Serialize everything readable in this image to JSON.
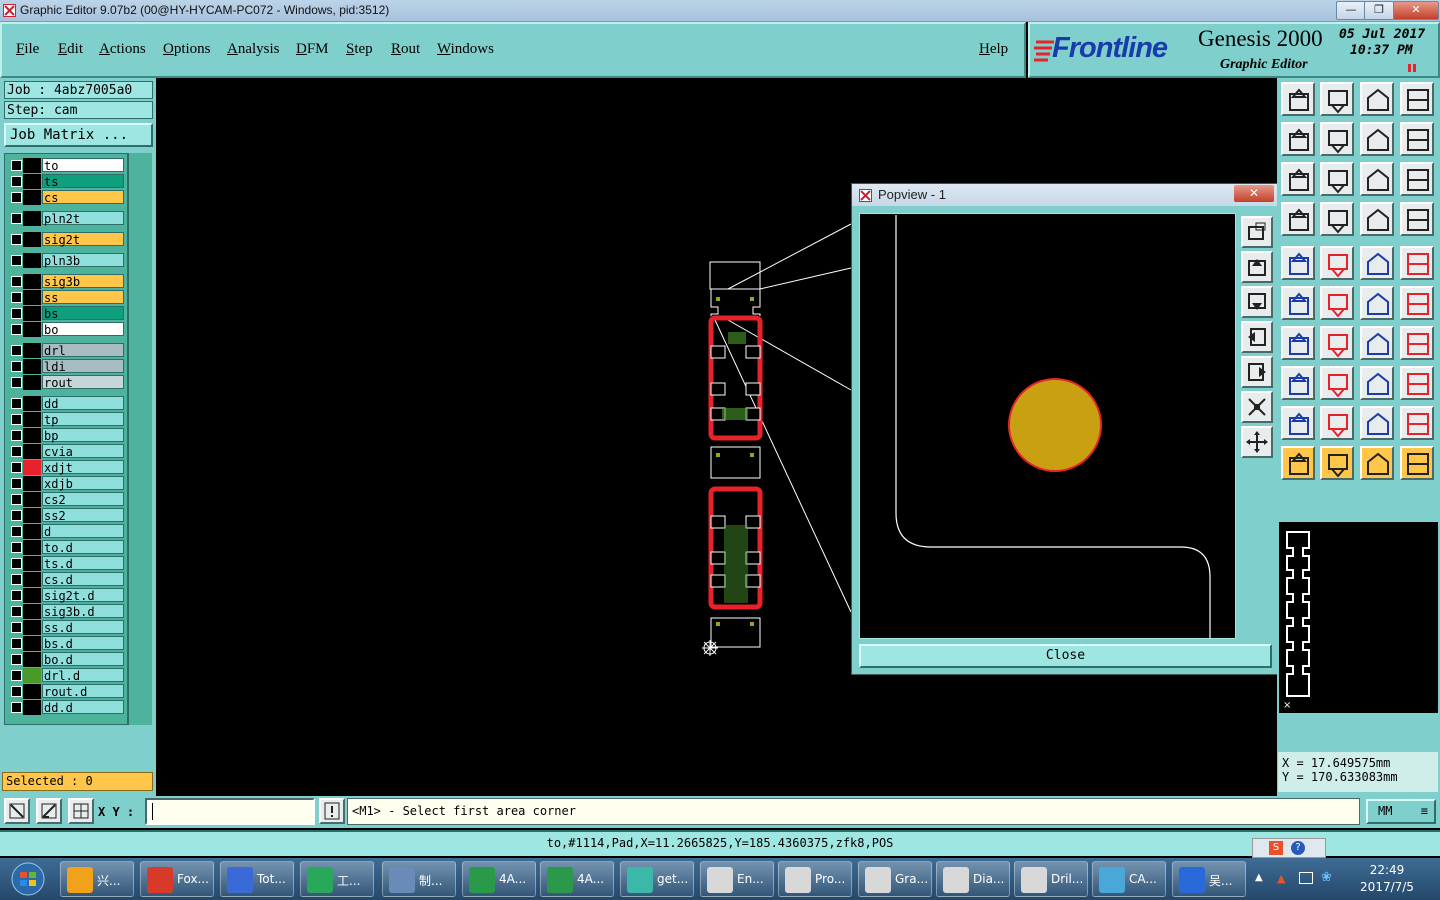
{
  "window": {
    "title": "Graphic Editor 9.07b2 (00@HY-HYCAM-PC072 - Windows, pid:3512)"
  },
  "menu": {
    "items": [
      "File",
      "Edit",
      "Actions",
      "Options",
      "Analysis",
      "DFM",
      "Step",
      "Rout",
      "Windows"
    ],
    "help": "Help"
  },
  "brand": {
    "logo": "Frontline",
    "product": "Genesis 2000",
    "subtitle": "Graphic Editor",
    "date": "05 Jul 2017",
    "time": "10:37 PM"
  },
  "job": {
    "name": "Job : 4abz7005a0",
    "step": "Step: cam",
    "matrix_button": "Job Matrix ..."
  },
  "layers": [
    {
      "name": "to",
      "color": "#ffffff",
      "swatch": "#000000"
    },
    {
      "name": "ts",
      "color": "#0f9e7e",
      "swatch": "#000000"
    },
    {
      "name": "cs",
      "color": "#ffc64a",
      "swatch": "#000000"
    },
    {
      "name": "pln2t",
      "color": "#8fe0dc",
      "swatch": "#000000"
    },
    {
      "name": "sig2t",
      "color": "#ffc64a",
      "swatch": "#000000"
    },
    {
      "name": "pln3b",
      "color": "#8fe0dc",
      "swatch": "#000000"
    },
    {
      "name": "sig3b",
      "color": "#ffc64a",
      "swatch": "#000000"
    },
    {
      "name": "ss",
      "color": "#ffc64a",
      "swatch": "#000000"
    },
    {
      "name": "bs",
      "color": "#0f9e7e",
      "swatch": "#000000"
    },
    {
      "name": "bo",
      "color": "#ffffff",
      "swatch": "#000000"
    },
    {
      "name": "drl",
      "color": "#a8bcc2",
      "swatch": "#000000"
    },
    {
      "name": "ldi",
      "color": "#a8bcc2",
      "swatch": "#000000"
    },
    {
      "name": "rout",
      "color": "#c6d6d8",
      "swatch": "#000000"
    },
    {
      "name": "dd",
      "color": "#8fe0dc",
      "swatch": "#000000"
    },
    {
      "name": "tp",
      "color": "#8fe0dc",
      "swatch": "#000000"
    },
    {
      "name": "bp",
      "color": "#8fe0dc",
      "swatch": "#000000"
    },
    {
      "name": "cvia",
      "color": "#8fe0dc",
      "swatch": "#000000"
    },
    {
      "name": "xdjt",
      "color": "#8fe0dc",
      "swatch": "#e8222a"
    },
    {
      "name": "xdjb",
      "color": "#8fe0dc",
      "swatch": "#000000"
    },
    {
      "name": "cs2",
      "color": "#8fe0dc",
      "swatch": "#000000"
    },
    {
      "name": "ss2",
      "color": "#8fe0dc",
      "swatch": "#000000"
    },
    {
      "name": "d",
      "color": "#8fe0dc",
      "swatch": "#000000"
    },
    {
      "name": "to.d",
      "color": "#8fe0dc",
      "swatch": "#000000"
    },
    {
      "name": "ts.d",
      "color": "#8fe0dc",
      "swatch": "#000000"
    },
    {
      "name": "cs.d",
      "color": "#8fe0dc",
      "swatch": "#000000"
    },
    {
      "name": "sig2t.d",
      "color": "#8fe0dc",
      "swatch": "#000000"
    },
    {
      "name": "sig3b.d",
      "color": "#8fe0dc",
      "swatch": "#000000"
    },
    {
      "name": "ss.d",
      "color": "#8fe0dc",
      "swatch": "#000000"
    },
    {
      "name": "bs.d",
      "color": "#8fe0dc",
      "swatch": "#000000"
    },
    {
      "name": "bo.d",
      "color": "#8fe0dc",
      "swatch": "#000000"
    },
    {
      "name": "drl.d",
      "color": "#8fe0dc",
      "swatch": "#4a9a2a"
    },
    {
      "name": "rout.d",
      "color": "#8fe0dc",
      "swatch": "#000000"
    },
    {
      "name": "dd.d",
      "color": "#8fe0dc",
      "swatch": "#000000"
    }
  ],
  "selected": "Selected : 0",
  "popview": {
    "title": "Popview - 1",
    "close_button": "Close"
  },
  "coords": {
    "x": "X  =  17.649575mm",
    "y": "Y  = 170.633083mm"
  },
  "command": {
    "xy_label": "X Y :",
    "xy_value": "",
    "prompt": "<M1> - Select first area corner",
    "units": "MM"
  },
  "status": "to,#1114,Pad,X=11.2665825,Y=185.4360375,zfk8,POS",
  "taskbar": {
    "items": [
      "兴...",
      "Fox...",
      "Tot...",
      "工...",
      "制...",
      "4A...",
      "4A...",
      "get...",
      "En...",
      "Pro...",
      "Gra...",
      "Dia...",
      "Dril...",
      "CA...",
      "吴..."
    ],
    "clock_time": "22:49",
    "clock_date": "2017/7/5"
  },
  "colors": {
    "panel": "#7fd0cc",
    "accent": "#ffc64a",
    "copper_pad": "#c9a012",
    "outline_red": "#e8222a"
  }
}
